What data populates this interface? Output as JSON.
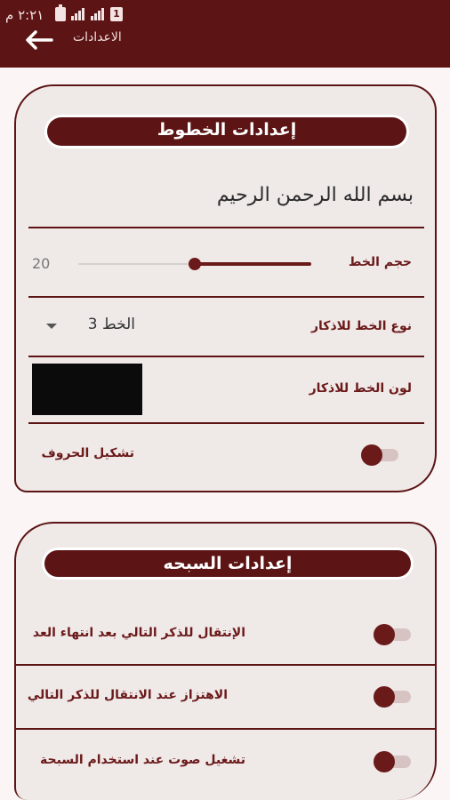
{
  "status_bar": {
    "time": "٢:٢١ م",
    "sim_slot": "1"
  },
  "app_bar": {
    "title": "الاعدادات"
  },
  "font_settings": {
    "heading": "إعدادات الخطوط",
    "preview_text": "بسم الله الرحمن الرحيم",
    "font_size": {
      "label": "حجم الخط",
      "value": "20",
      "level": 0.5
    },
    "font_type": {
      "label": "نوع الخط للاذكار",
      "selected": "الخط 3"
    },
    "font_color": {
      "label": "لون الخط للاذكار",
      "color": "#0b0b0b"
    },
    "diacritics": {
      "label": "تشكيل الحروف",
      "enabled": false
    }
  },
  "rosary_settings": {
    "heading": "إعدادات السبحه",
    "items": [
      {
        "label": "الإنتقال للذكر التالي بعد انتهاء العد",
        "enabled": false
      },
      {
        "label": "الاهتزاز عند الانتقال للذكر التالي",
        "enabled": false
      },
      {
        "label": "تشغيل صوت عند استخدام السبحة",
        "enabled": false
      }
    ]
  },
  "colors": {
    "primary": "#5c1414",
    "card": "#efe9e8",
    "background": "#fbf6f5"
  }
}
